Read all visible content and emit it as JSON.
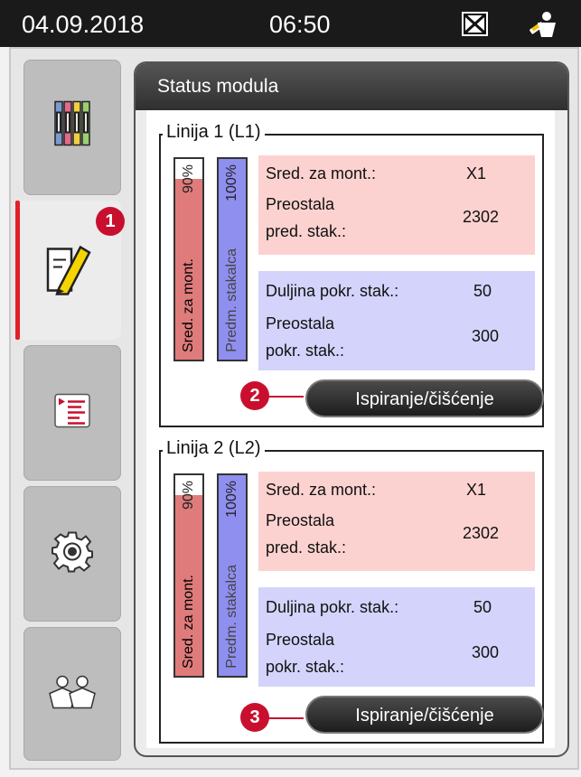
{
  "header": {
    "date": "04.09.2018",
    "time": "06:50",
    "error_icon": "error-status-icon",
    "user_icon": "user-status-icon"
  },
  "sidebar": {
    "items": [
      {
        "icon": "reagents-icon",
        "active": false
      },
      {
        "icon": "module-status-icon",
        "active": true
      },
      {
        "icon": "program-list-icon",
        "active": false
      },
      {
        "icon": "settings-gear-icon",
        "active": false
      },
      {
        "icon": "user-settings-icon",
        "active": false
      }
    ]
  },
  "callouts": {
    "c1": "1",
    "c2": "2",
    "c3": "3"
  },
  "panel": {
    "title": "Status modula"
  },
  "lines": [
    {
      "title": "Linija 1 (L1)",
      "mount_medium": {
        "percent": "90%",
        "level": 0.9,
        "label": "Sred. za mont.",
        "color": "#e07b7b"
      },
      "slides": {
        "percent": "100%",
        "level": 1.0,
        "label": "Predm. stakalca",
        "color": "#8f8ff0"
      },
      "mount_info": {
        "label_medium": "Sred. za mont.:",
        "value_medium": "X1",
        "label_remaining_1": "Preostala",
        "label_remaining_2": "pred. stak.:",
        "value_remaining": "2302"
      },
      "coverslip_info": {
        "label_length": "Duljina pokr. stak.:",
        "value_length": "50",
        "label_remaining_1": "Preostala",
        "label_remaining_2": "pokr. stak.:",
        "value_remaining": "300"
      },
      "button": "Ispiranje/čišćenje"
    },
    {
      "title": "Linija 2 (L2)",
      "mount_medium": {
        "percent": "90%",
        "level": 0.9,
        "label": "Sred. za mont.",
        "color": "#e07b7b"
      },
      "slides": {
        "percent": "100%",
        "level": 1.0,
        "label": "Predm. stakalca",
        "color": "#8f8ff0"
      },
      "mount_info": {
        "label_medium": "Sred. za mont.:",
        "value_medium": "X1",
        "label_remaining_1": "Preostala",
        "label_remaining_2": "pred. stak.:",
        "value_remaining": "2302"
      },
      "coverslip_info": {
        "label_length": "Duljina pokr. stak.:",
        "value_length": "50",
        "label_remaining_1": "Preostala",
        "label_remaining_2": "pokr. stak.:",
        "value_remaining": "300"
      },
      "button": "Ispiranje/čišćenje"
    }
  ],
  "colors": {
    "mount_bg": "#fcd2d0",
    "coverslip_bg": "#d3d3fb",
    "accent_red": "#e21f26",
    "callout_red": "#c8102e"
  }
}
